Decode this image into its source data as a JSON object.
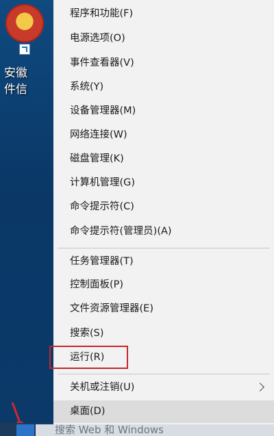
{
  "desktop": {
    "icon_label_line1": "安徽",
    "icon_label_line2": "件信"
  },
  "taskbar": {
    "search_text": "搜索 Web 和 Windows"
  },
  "menu": {
    "items": [
      {
        "label": "程序和功能(F)"
      },
      {
        "label": "电源选项(O)"
      },
      {
        "label": "事件查看器(V)"
      },
      {
        "label": "系统(Y)"
      },
      {
        "label": "设备管理器(M)"
      },
      {
        "label": "网络连接(W)"
      },
      {
        "label": "磁盘管理(K)"
      },
      {
        "label": "计算机管理(G)"
      },
      {
        "label": "命令提示符(C)"
      },
      {
        "label": "命令提示符(管理员)(A)"
      },
      {
        "label": "任务管理器(T)"
      },
      {
        "label": "控制面板(P)"
      },
      {
        "label": "文件资源管理器(E)"
      },
      {
        "label": "搜索(S)"
      },
      {
        "label": "运行(R)"
      },
      {
        "label": "关机或注销(U)"
      },
      {
        "label": "桌面(D)"
      }
    ]
  },
  "colors": {
    "highlight_border": "#c2252b",
    "menu_bg": "#f2f2f2",
    "hover_bg": "#dcdcdc"
  }
}
